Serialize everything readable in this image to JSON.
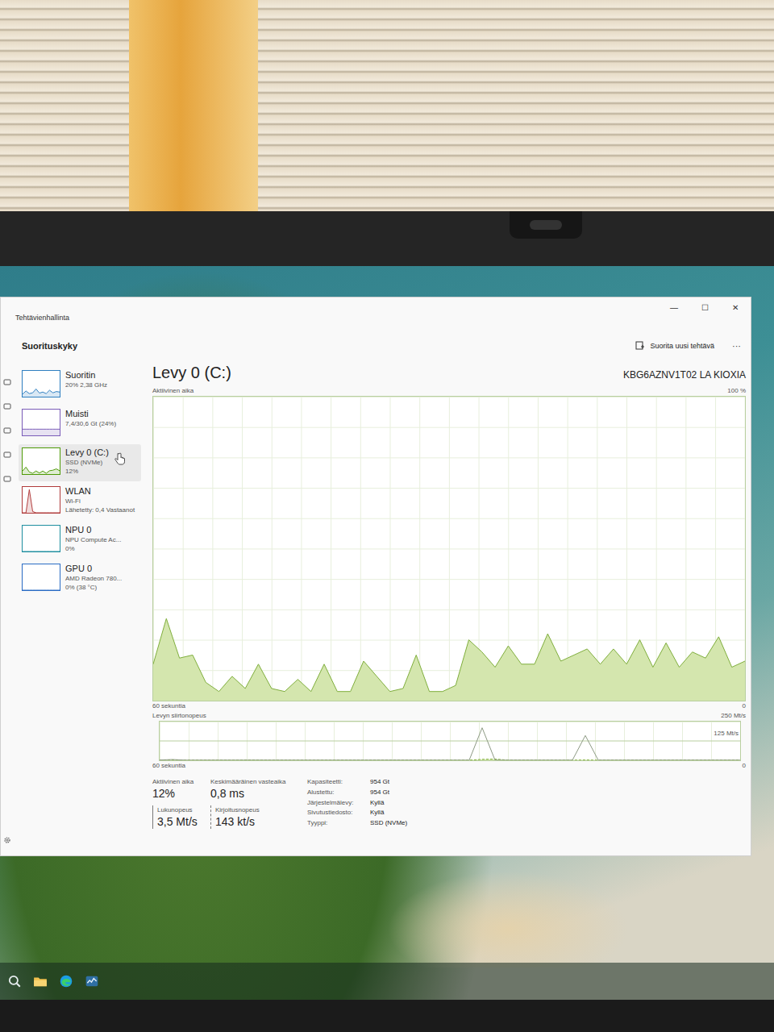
{
  "window": {
    "title": "Tehtävienhallinta",
    "controls": [
      "—",
      "☐",
      "✕"
    ]
  },
  "toolbar": {
    "heading": "Suorituskyky",
    "run_task": "Suorita uusi tehtävä",
    "more": "···"
  },
  "sidebar": {
    "items": [
      {
        "name": "Suoritin",
        "lines": [
          "20% 2,38 GHz"
        ],
        "selected": false,
        "color": "#2f7fc1",
        "max": 100,
        "spark": [
          10,
          22,
          12,
          15,
          30,
          14,
          18,
          12,
          25,
          15,
          20,
          18
        ]
      },
      {
        "name": "Muisti",
        "lines": [
          "7,4/30,6 Gt (24%)"
        ],
        "selected": false,
        "color": "#7a5cb8",
        "max": 100,
        "spark": [
          24,
          24,
          24,
          24,
          24,
          24,
          24,
          24,
          24,
          24,
          24,
          24
        ]
      },
      {
        "name": "Levy 0 (C:)",
        "lines": [
          "SSD (NVMe)",
          "12%"
        ],
        "selected": true,
        "color": "#4e9a06",
        "max": 100,
        "spark": [
          12,
          27,
          8,
          3,
          12,
          4,
          12,
          3,
          13,
          15,
          20,
          13
        ]
      },
      {
        "name": "WLAN",
        "lines": [
          "Wi-Fi",
          "Lähetetty: 0,4 Vastaanot"
        ],
        "selected": false,
        "color": "#b03a3a",
        "max": 100,
        "spark": [
          0,
          0,
          90,
          5,
          0,
          0,
          0,
          0,
          0,
          0,
          0,
          0
        ]
      },
      {
        "name": "NPU 0",
        "lines": [
          "NPU Compute Ac...",
          "0%"
        ],
        "selected": false,
        "color": "#1f8fa0",
        "max": 100,
        "spark": [
          0,
          0,
          0,
          0,
          0,
          0,
          0,
          0,
          0,
          0,
          0,
          0
        ]
      },
      {
        "name": "GPU 0",
        "lines": [
          "AMD Radeon 780...",
          "0% (38 °C)"
        ],
        "selected": false,
        "color": "#2a6cc4",
        "max": 100,
        "spark": [
          0,
          0,
          0,
          0,
          0,
          0,
          0,
          0,
          0,
          0,
          0,
          0
        ]
      }
    ]
  },
  "detail": {
    "title": "Levy 0 (C:)",
    "model": "KBG6AZNV1T02 LA KIOXIA",
    "active_chart": {
      "label": "Aktiivinen aika",
      "max_label": "100 %",
      "time_label": "60 sekuntia",
      "min_label": "0",
      "max": 100,
      "values": [
        12,
        27,
        14,
        15,
        6,
        3,
        8,
        4,
        12,
        4,
        3,
        7,
        3,
        12,
        3,
        3,
        13,
        8,
        3,
        4,
        15,
        3,
        3,
        5,
        20,
        16,
        11,
        18,
        12,
        12,
        22,
        13,
        15,
        17,
        12,
        17,
        12,
        20,
        11,
        19,
        11,
        16,
        14,
        21,
        11,
        13
      ]
    },
    "transfer_chart": {
      "label": "Levyn siirtonopeus",
      "max_label": "250 Mt/s",
      "mid_label": "125 Mt/s",
      "time_label": "60 sekuntia",
      "min_label": "0",
      "max": 250,
      "read": [
        2,
        5,
        1,
        1,
        1,
        1,
        1,
        1,
        1,
        1,
        1,
        1,
        1,
        1,
        1,
        1,
        1,
        1,
        1,
        1,
        1,
        1,
        1,
        1,
        1,
        210,
        1,
        1,
        1,
        1,
        1,
        1,
        1,
        160,
        1,
        1,
        1,
        1,
        1,
        1,
        1,
        1,
        1,
        1,
        1,
        1
      ],
      "write": [
        1,
        2,
        1,
        1,
        1,
        1,
        1,
        2,
        1,
        1,
        1,
        1,
        1,
        1,
        1,
        1,
        1,
        1,
        1,
        1,
        1,
        1,
        1,
        1,
        1,
        6,
        8,
        1,
        1,
        1,
        1,
        1,
        1,
        2,
        1,
        1,
        1,
        1,
        1,
        1,
        1,
        1,
        1,
        1,
        1,
        1
      ]
    },
    "stats": [
      {
        "label": "Aktiivinen aika",
        "value": "12%"
      },
      {
        "label": "Keskimääräinen vasteaika",
        "value": "0,8 ms"
      }
    ],
    "speeds": [
      {
        "label": "Lukunopeus",
        "value": "3,5 Mt/s",
        "kind": "solid"
      },
      {
        "label": "Kirjoitusnopeus",
        "value": "143 kt/s",
        "kind": "dashed"
      }
    ],
    "properties": [
      {
        "label": "Kapasiteetti:",
        "value": "954 Gt"
      },
      {
        "label": "Alustettu:",
        "value": "954 Gt"
      },
      {
        "label": "Järjestelmälevy:",
        "value": "Kyllä"
      },
      {
        "label": "Sivutustiedosto:",
        "value": "Kyllä"
      },
      {
        "label": "Tyyppi:",
        "value": "SSD (NVMe)"
      }
    ]
  }
}
